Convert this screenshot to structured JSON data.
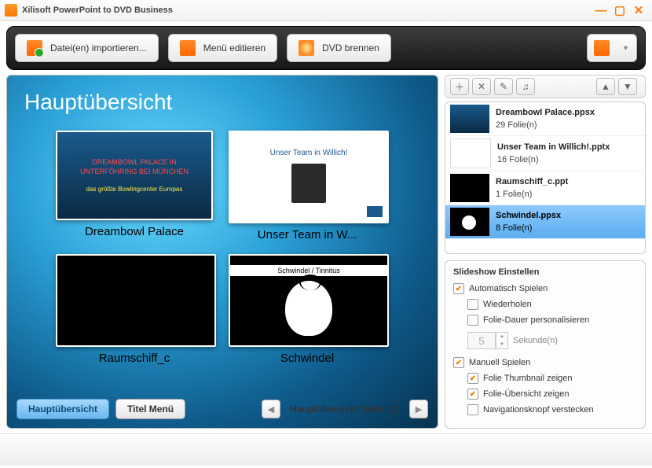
{
  "window": {
    "title": "Xilisoft PowerPoint to DVD Business"
  },
  "toolbar": {
    "import": "Datei(en) importieren...",
    "menu": "Menü editieren",
    "burn": "DVD brennen"
  },
  "preview": {
    "heading": "Hauptübersicht",
    "slides": [
      {
        "caption": "Dreambowl Palace",
        "thumb": {
          "l1": "DREAMBOWL PALACE IN UNTERFÖHRING BEI MÜNCHEN",
          "l2": "das größte Bowlingcenter Europas"
        }
      },
      {
        "caption": "Unser Team in W...",
        "thumb": {
          "hdr": "Unser Team in Willich!"
        }
      },
      {
        "caption": "Raumschiff_c",
        "thumb": {}
      },
      {
        "caption": "Schwindel",
        "thumb": {
          "bar": "Schwindel / Tinnitus"
        }
      }
    ],
    "nav": {
      "haupt": "Hauptübersicht",
      "titel": "Titel Menü",
      "page": "Hauptübersicht Seite 1/1"
    }
  },
  "files": [
    {
      "name": "Dreambowl Palace.ppsx",
      "count": "29 Folie(n)",
      "thumbClass": "t1",
      "selected": false
    },
    {
      "name": "Unser Team in Willich!.pptx",
      "count": "16 Folie(n)",
      "thumbClass": "t2",
      "selected": false
    },
    {
      "name": "Raumschiff_c.ppt",
      "count": "1 Folie(n)",
      "thumbClass": "t3",
      "selected": false
    },
    {
      "name": "Schwindel.ppsx",
      "count": "8 Folie(n)",
      "thumbClass": "t4",
      "selected": true
    }
  ],
  "settings": {
    "title": "Slideshow Einstellen",
    "auto": "Automatisch Spielen",
    "repeat": "Wiederholen",
    "dur": "Folie-Dauer personalisieren",
    "durVal": "5",
    "durUnit": "Sekunde(n)",
    "manual": "Manuell Spielen",
    "thumb": "Folie Thumbnail zeigen",
    "over": "Folie-Übersicht zeigen",
    "navhide": "Navigationsknopf verstecken"
  }
}
